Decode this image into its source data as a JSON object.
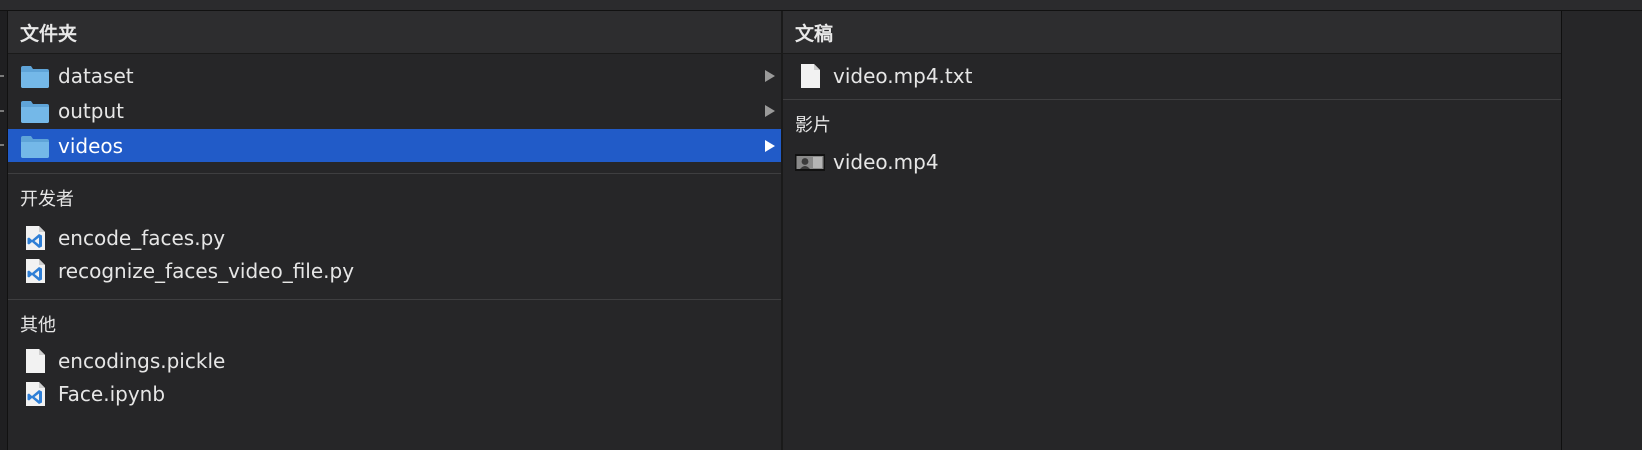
{
  "columns": {
    "left": {
      "header": "文件夹",
      "folders": [
        {
          "name": "dataset",
          "has_children": true,
          "selected": false
        },
        {
          "name": "output",
          "has_children": true,
          "selected": false
        },
        {
          "name": "videos",
          "has_children": true,
          "selected": true
        }
      ],
      "sections": [
        {
          "label": "开发者",
          "items": [
            {
              "name": "encode_faces.py",
              "icon": "vscode-file-icon"
            },
            {
              "name": "recognize_faces_video_file.py",
              "icon": "vscode-file-icon"
            }
          ]
        },
        {
          "label": "其他",
          "items": [
            {
              "name": "encodings.pickle",
              "icon": "document-icon"
            },
            {
              "name": "Face.ipynb",
              "icon": "vscode-file-icon"
            }
          ]
        }
      ]
    },
    "right": {
      "header": "文稿",
      "items": [
        {
          "name": "video.mp4.txt",
          "icon": "document-icon"
        }
      ],
      "sections": [
        {
          "label": "影片",
          "items": [
            {
              "name": "video.mp4",
              "icon": "video-thumbnail-icon"
            }
          ]
        }
      ]
    }
  },
  "colors": {
    "selection": "#215bc8",
    "folder": "#6fb0e0",
    "vscode": "#2f7fd6"
  }
}
